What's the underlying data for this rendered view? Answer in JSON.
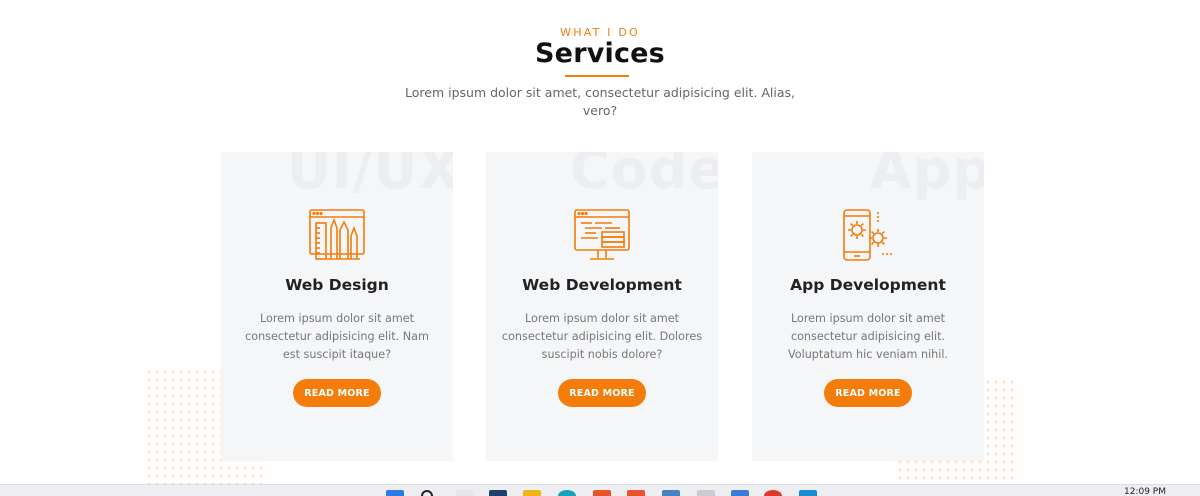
{
  "section": {
    "eyebrow": "WHAT I DO",
    "title": "Services",
    "subtitle": "Lorem ipsum dolor sit amet, consectetur adipisicing elit. Alias, vero?"
  },
  "cards": [
    {
      "watermark": "UI/UX",
      "icon": "web-design-icon",
      "title": "Web Design",
      "text": "Lorem ipsum dolor sit amet consectetur adipisicing elit. Nam est suscipit itaque?",
      "button": "READ MORE"
    },
    {
      "watermark": "Code",
      "icon": "web-development-icon",
      "title": "Web Development",
      "text": "Lorem ipsum dolor sit amet consectetur adipisicing elit. Dolores suscipit nobis dolore?",
      "button": "READ MORE"
    },
    {
      "watermark": "App",
      "icon": "app-development-icon",
      "title": "App Development",
      "text": "Lorem ipsum dolor sit amet consectetur adipisicing elit. Voluptatum hic veniam nihil.",
      "button": "READ MORE"
    }
  ],
  "taskbar": {
    "clock": "12:09 PM",
    "icons": [
      "windows-start-icon",
      "search-icon",
      "task-view-icon",
      "file-explorer-icon",
      "folder-icon",
      "edge-browser-icon",
      "app-icon",
      "app-icon",
      "app-icon",
      "app-icon",
      "calendar-icon",
      "chrome-icon",
      "vscode-icon"
    ]
  },
  "colors": {
    "accent": "#f47c0b",
    "card_bg": "#f5f6f8",
    "title": "#111111",
    "body_text": "#777777"
  }
}
